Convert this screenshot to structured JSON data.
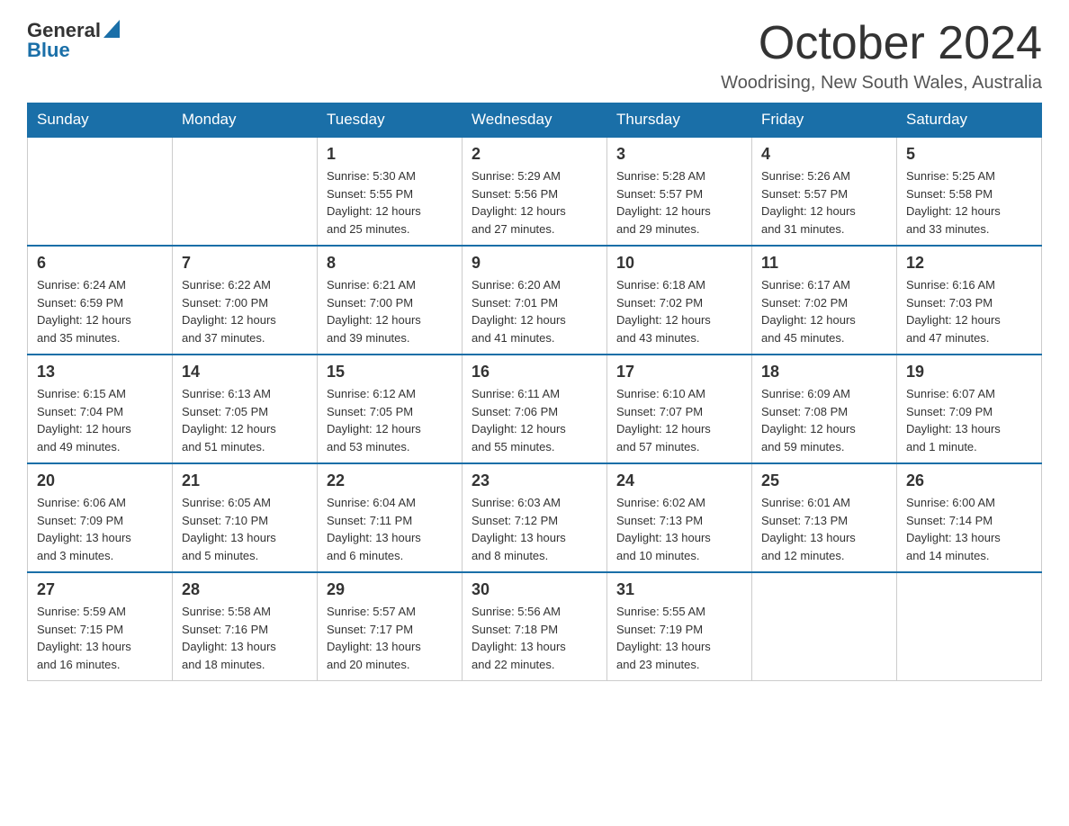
{
  "header": {
    "logo_general": "General",
    "logo_blue": "Blue",
    "month_title": "October 2024",
    "location": "Woodrising, New South Wales, Australia"
  },
  "days_of_week": [
    "Sunday",
    "Monday",
    "Tuesday",
    "Wednesday",
    "Thursday",
    "Friday",
    "Saturday"
  ],
  "weeks": [
    [
      {
        "day": "",
        "info": ""
      },
      {
        "day": "",
        "info": ""
      },
      {
        "day": "1",
        "info": "Sunrise: 5:30 AM\nSunset: 5:55 PM\nDaylight: 12 hours\nand 25 minutes."
      },
      {
        "day": "2",
        "info": "Sunrise: 5:29 AM\nSunset: 5:56 PM\nDaylight: 12 hours\nand 27 minutes."
      },
      {
        "day": "3",
        "info": "Sunrise: 5:28 AM\nSunset: 5:57 PM\nDaylight: 12 hours\nand 29 minutes."
      },
      {
        "day": "4",
        "info": "Sunrise: 5:26 AM\nSunset: 5:57 PM\nDaylight: 12 hours\nand 31 minutes."
      },
      {
        "day": "5",
        "info": "Sunrise: 5:25 AM\nSunset: 5:58 PM\nDaylight: 12 hours\nand 33 minutes."
      }
    ],
    [
      {
        "day": "6",
        "info": "Sunrise: 6:24 AM\nSunset: 6:59 PM\nDaylight: 12 hours\nand 35 minutes."
      },
      {
        "day": "7",
        "info": "Sunrise: 6:22 AM\nSunset: 7:00 PM\nDaylight: 12 hours\nand 37 minutes."
      },
      {
        "day": "8",
        "info": "Sunrise: 6:21 AM\nSunset: 7:00 PM\nDaylight: 12 hours\nand 39 minutes."
      },
      {
        "day": "9",
        "info": "Sunrise: 6:20 AM\nSunset: 7:01 PM\nDaylight: 12 hours\nand 41 minutes."
      },
      {
        "day": "10",
        "info": "Sunrise: 6:18 AM\nSunset: 7:02 PM\nDaylight: 12 hours\nand 43 minutes."
      },
      {
        "day": "11",
        "info": "Sunrise: 6:17 AM\nSunset: 7:02 PM\nDaylight: 12 hours\nand 45 minutes."
      },
      {
        "day": "12",
        "info": "Sunrise: 6:16 AM\nSunset: 7:03 PM\nDaylight: 12 hours\nand 47 minutes."
      }
    ],
    [
      {
        "day": "13",
        "info": "Sunrise: 6:15 AM\nSunset: 7:04 PM\nDaylight: 12 hours\nand 49 minutes."
      },
      {
        "day": "14",
        "info": "Sunrise: 6:13 AM\nSunset: 7:05 PM\nDaylight: 12 hours\nand 51 minutes."
      },
      {
        "day": "15",
        "info": "Sunrise: 6:12 AM\nSunset: 7:05 PM\nDaylight: 12 hours\nand 53 minutes."
      },
      {
        "day": "16",
        "info": "Sunrise: 6:11 AM\nSunset: 7:06 PM\nDaylight: 12 hours\nand 55 minutes."
      },
      {
        "day": "17",
        "info": "Sunrise: 6:10 AM\nSunset: 7:07 PM\nDaylight: 12 hours\nand 57 minutes."
      },
      {
        "day": "18",
        "info": "Sunrise: 6:09 AM\nSunset: 7:08 PM\nDaylight: 12 hours\nand 59 minutes."
      },
      {
        "day": "19",
        "info": "Sunrise: 6:07 AM\nSunset: 7:09 PM\nDaylight: 13 hours\nand 1 minute."
      }
    ],
    [
      {
        "day": "20",
        "info": "Sunrise: 6:06 AM\nSunset: 7:09 PM\nDaylight: 13 hours\nand 3 minutes."
      },
      {
        "day": "21",
        "info": "Sunrise: 6:05 AM\nSunset: 7:10 PM\nDaylight: 13 hours\nand 5 minutes."
      },
      {
        "day": "22",
        "info": "Sunrise: 6:04 AM\nSunset: 7:11 PM\nDaylight: 13 hours\nand 6 minutes."
      },
      {
        "day": "23",
        "info": "Sunrise: 6:03 AM\nSunset: 7:12 PM\nDaylight: 13 hours\nand 8 minutes."
      },
      {
        "day": "24",
        "info": "Sunrise: 6:02 AM\nSunset: 7:13 PM\nDaylight: 13 hours\nand 10 minutes."
      },
      {
        "day": "25",
        "info": "Sunrise: 6:01 AM\nSunset: 7:13 PM\nDaylight: 13 hours\nand 12 minutes."
      },
      {
        "day": "26",
        "info": "Sunrise: 6:00 AM\nSunset: 7:14 PM\nDaylight: 13 hours\nand 14 minutes."
      }
    ],
    [
      {
        "day": "27",
        "info": "Sunrise: 5:59 AM\nSunset: 7:15 PM\nDaylight: 13 hours\nand 16 minutes."
      },
      {
        "day": "28",
        "info": "Sunrise: 5:58 AM\nSunset: 7:16 PM\nDaylight: 13 hours\nand 18 minutes."
      },
      {
        "day": "29",
        "info": "Sunrise: 5:57 AM\nSunset: 7:17 PM\nDaylight: 13 hours\nand 20 minutes."
      },
      {
        "day": "30",
        "info": "Sunrise: 5:56 AM\nSunset: 7:18 PM\nDaylight: 13 hours\nand 22 minutes."
      },
      {
        "day": "31",
        "info": "Sunrise: 5:55 AM\nSunset: 7:19 PM\nDaylight: 13 hours\nand 23 minutes."
      },
      {
        "day": "",
        "info": ""
      },
      {
        "day": "",
        "info": ""
      }
    ]
  ]
}
